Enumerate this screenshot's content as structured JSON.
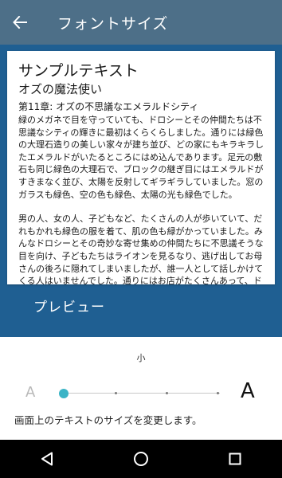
{
  "appbar": {
    "title": "フォントサイズ",
    "back_icon": "arrow-back-icon"
  },
  "preview": {
    "sample_title": "サンプルテキスト",
    "book_title": "オズの魔法使い",
    "chapter": "第11章: オズの不思議なエメラルドシティ",
    "paragraph1": "緑のメガネで目を守っていても、ドロシーとその仲間たちは不思議なシティの輝きに最初はくらくらしました。通りには緑色の大理石造りの美しい家々が建ち並び、どの家にもキラキラしたエメラルドがいたるところにはめ込んであります。足元の敷石も同じ緑色の大理石で、ブロックの継ぎ目にはエメラルドがすきまなく並び、太陽を反射してギラギラしていました。窓のガラスも緑色、空の色も緑色、太陽の光も緑色でした。",
    "paragraph2": "男の人、女の人、子どもなど、たくさんの人が歩いていて、だれもかれも緑色の服を着て、肌の色も緑がかっていました。みんなドロシーとその奇妙な寄せ集めの仲間たちに不思議そうな目を向け、子どもたちはライオンを見るなり、逃げ出してお母さんの後ろに隠れてしまいましたが、誰一人として話しかけてくる人はいませんでした。通りにはお店がたくさんあって、ドロシーはそこで売られている",
    "label": "プレビュー"
  },
  "font_size": {
    "current_label": "小",
    "small_a": "A",
    "large_a": "A",
    "steps": 4,
    "selected_index": 0,
    "accent_color": "#3bb4c6",
    "description": "画面上のテキストのサイズを変更します。"
  },
  "navbar": {
    "back_icon": "nav-back-triangle-icon",
    "home_icon": "nav-home-circle-icon",
    "recents_icon": "nav-recents-square-icon"
  },
  "colors": {
    "appbar": "#4d6f88",
    "preview_bg": "#1f5f92",
    "navbar": "#000000"
  }
}
